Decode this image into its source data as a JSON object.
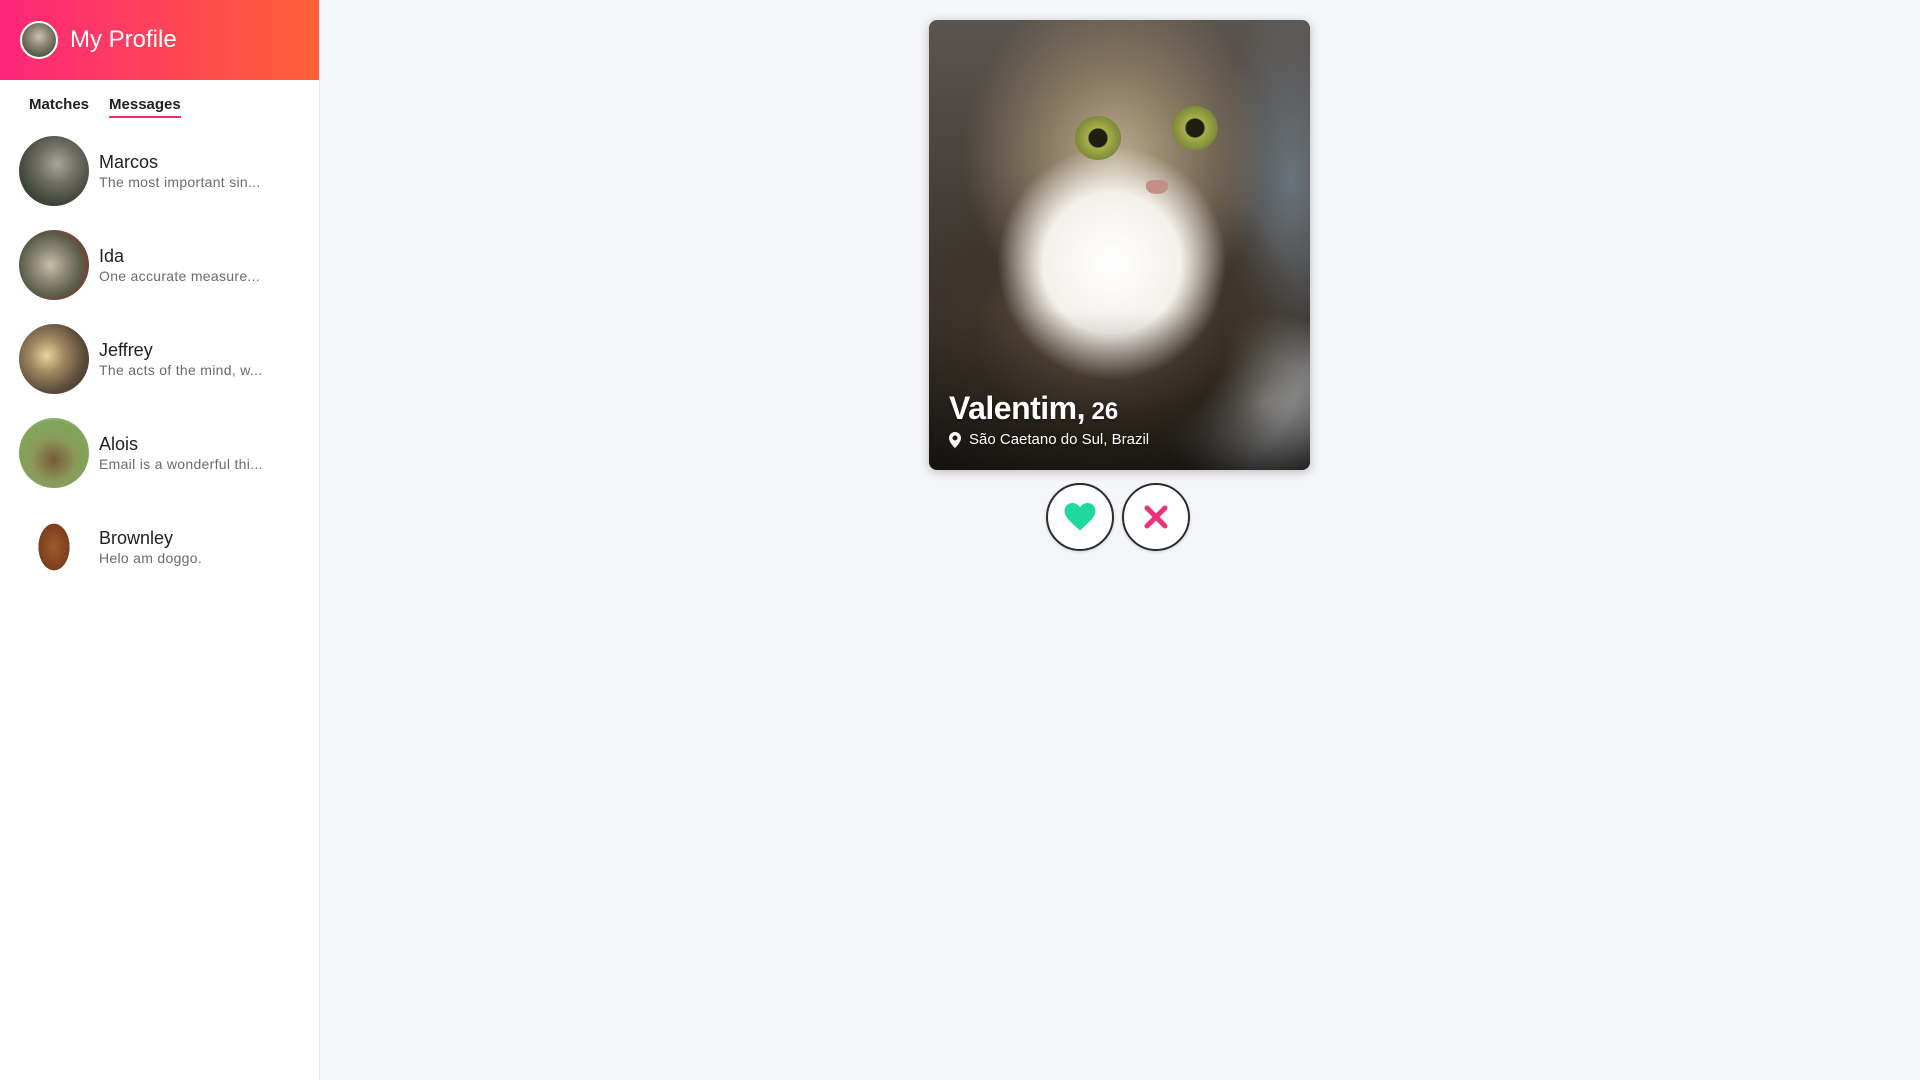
{
  "sidebar": {
    "header": {
      "title": "My Profile",
      "avatar_icon": "profile-avatar"
    },
    "tabs": [
      {
        "label": "Matches",
        "active": false
      },
      {
        "label": "Messages",
        "active": true
      }
    ],
    "messages": [
      {
        "name": "Marcos",
        "preview": "The most important sin..."
      },
      {
        "name": "Ida",
        "preview": "One accurate measure..."
      },
      {
        "name": "Jeffrey",
        "preview": "The acts of the mind, w..."
      },
      {
        "name": "Alois",
        "preview": "Email is a wonderful thi..."
      },
      {
        "name": "Brownley",
        "preview": "Helo am doggo."
      }
    ]
  },
  "card": {
    "name": "Valentim",
    "comma": ",",
    "age": "26",
    "location": "São Caetano do Sul, Brazil",
    "location_icon": "map-pin-icon"
  },
  "actions": {
    "like_icon": "heart-icon",
    "like_color": "#1fd8a0",
    "dislike_icon": "close-icon",
    "dislike_color": "#f0307a"
  },
  "colors": {
    "header_gradient_start": "#fd267a",
    "header_gradient_end": "#ff6036",
    "tab_underline": "#fd267a",
    "background": "#f5f6fa"
  }
}
